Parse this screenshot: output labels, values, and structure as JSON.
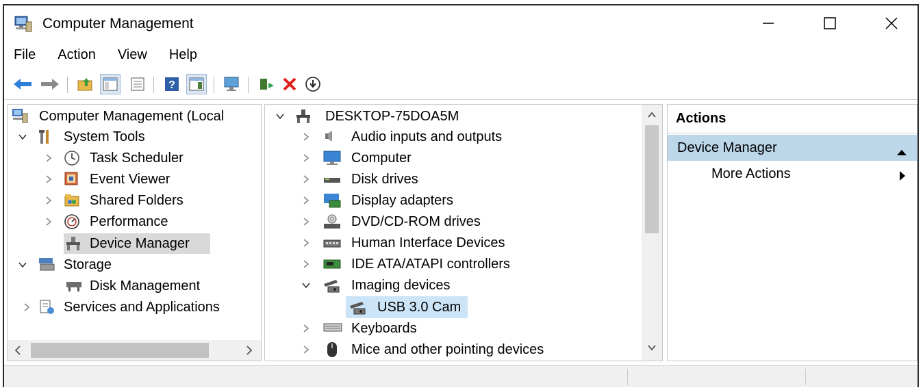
{
  "window": {
    "title": "Computer Management"
  },
  "menu": [
    "File",
    "Action",
    "View",
    "Help"
  ],
  "left_tree": {
    "root": "Computer Management (Local",
    "system_tools": "System Tools",
    "task_scheduler": "Task Scheduler",
    "event_viewer": "Event Viewer",
    "shared_folders": "Shared Folders",
    "performance": "Performance",
    "device_manager": "Device Manager",
    "storage": "Storage",
    "disk_management": "Disk Management",
    "services": "Services and Applications"
  },
  "device_tree": {
    "computer_name": "DESKTOP-75DOA5M",
    "items": [
      "Audio inputs and outputs",
      "Computer",
      "Disk drives",
      "Display adapters",
      "DVD/CD-ROM drives",
      "Human Interface Devices",
      "IDE ATA/ATAPI controllers",
      "Imaging devices",
      "USB 3.0 Cam",
      "Keyboards",
      "Mice and other pointing devices"
    ]
  },
  "actions": {
    "header": "Actions",
    "selected": "Device Manager",
    "more": "More Actions"
  },
  "colors": {
    "selection_blue": "#cce4f7",
    "actions_selected": "#bcd6ea",
    "close_red": "#e0201b"
  }
}
